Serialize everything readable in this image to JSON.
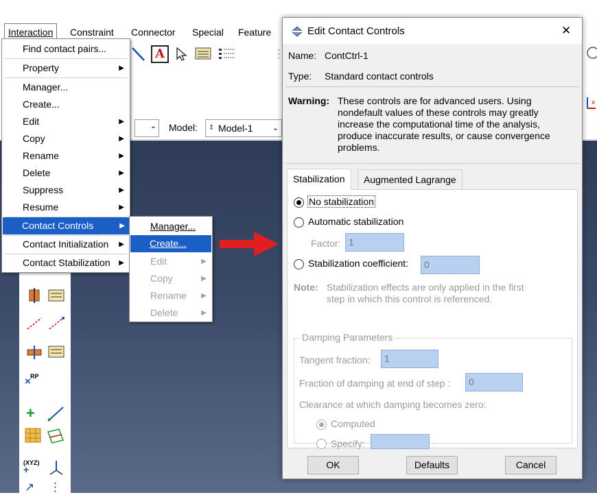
{
  "menubar": {
    "items": [
      {
        "label": "Interaction",
        "key": "I",
        "rest": "nteraction"
      },
      {
        "label": "Constraint"
      },
      {
        "label": "Connector"
      },
      {
        "label": "Special"
      },
      {
        "label": "Feature"
      }
    ]
  },
  "modelbar": {
    "model_label": "Model:",
    "model_value": "Model-1"
  },
  "interaction_menu": {
    "items": [
      {
        "label": "Find contact pairs...",
        "submenu": false
      },
      {
        "label": "Property",
        "submenu": true
      },
      {
        "label": "Manager...",
        "submenu": false
      },
      {
        "label": "Create...",
        "submenu": false
      },
      {
        "label": "Edit",
        "submenu": true
      },
      {
        "label": "Copy",
        "submenu": true
      },
      {
        "label": "Rename",
        "submenu": true
      },
      {
        "label": "Delete",
        "submenu": true
      },
      {
        "label": "Suppress",
        "submenu": true
      },
      {
        "label": "Resume",
        "submenu": true
      },
      {
        "label": "Contact Controls",
        "submenu": true,
        "highlighted": true
      },
      {
        "label": "Contact Initialization",
        "submenu": true
      },
      {
        "label": "Contact Stabilization",
        "submenu": true
      }
    ]
  },
  "contact_controls_submenu": {
    "items": [
      {
        "label": "Manager...",
        "enabled": true
      },
      {
        "label": "Create...",
        "enabled": true,
        "highlighted": true
      },
      {
        "label": "Edit",
        "enabled": false
      },
      {
        "label": "Copy",
        "enabled": false
      },
      {
        "label": "Rename",
        "enabled": false
      },
      {
        "label": "Delete",
        "enabled": false
      }
    ]
  },
  "left_tools": {
    "rp_label": "RP",
    "xyz_label": "(XYZ)"
  },
  "dialog": {
    "title": "Edit Contact Controls",
    "close_symbol": "✕",
    "name_label": "Name:",
    "name_value": "ContCtrl-1",
    "type_label": "Type:",
    "type_value": "Standard contact controls",
    "warning_label": "Warning:",
    "warning_text": "These controls are for advanced users. Using nondefault values of these controls may greatly increase the computational time of the analysis, produce inaccurate results, or cause convergence problems.",
    "tabs": [
      "Stabilization",
      "Augmented Lagrange"
    ],
    "selected_tab": "Stabilization",
    "options": {
      "no_stabilization": "No stabilization",
      "automatic_stabilization": "Automatic stabilization",
      "factor_label": "Factor:",
      "factor_value": "1",
      "stabilization_coefficient": "Stabilization coefficient:",
      "coefficient_value": "0",
      "selected": "No stabilization"
    },
    "note_label": "Note:",
    "note_text": "Stabilization effects are only applied in the first step in which this control is referenced.",
    "damping": {
      "legend": "Damping Parameters",
      "tangent_label": "Tangent fraction:",
      "tangent_value": "1",
      "fraction_end_label": "Fraction of damping at end of step :",
      "fraction_end_value": "0",
      "clearance_label": "Clearance at which damping becomes zero:",
      "computed_label": "Computed",
      "specify_label": "Specify:",
      "specify_value": "",
      "selected": "Computed"
    },
    "buttons": {
      "ok": "OK",
      "defaults": "Defaults",
      "cancel": "Cancel"
    }
  },
  "colors": {
    "highlight": "#1a5fc6",
    "field": "#bcd4f2",
    "arrow": "#e02020",
    "viewport": "#34425f"
  }
}
